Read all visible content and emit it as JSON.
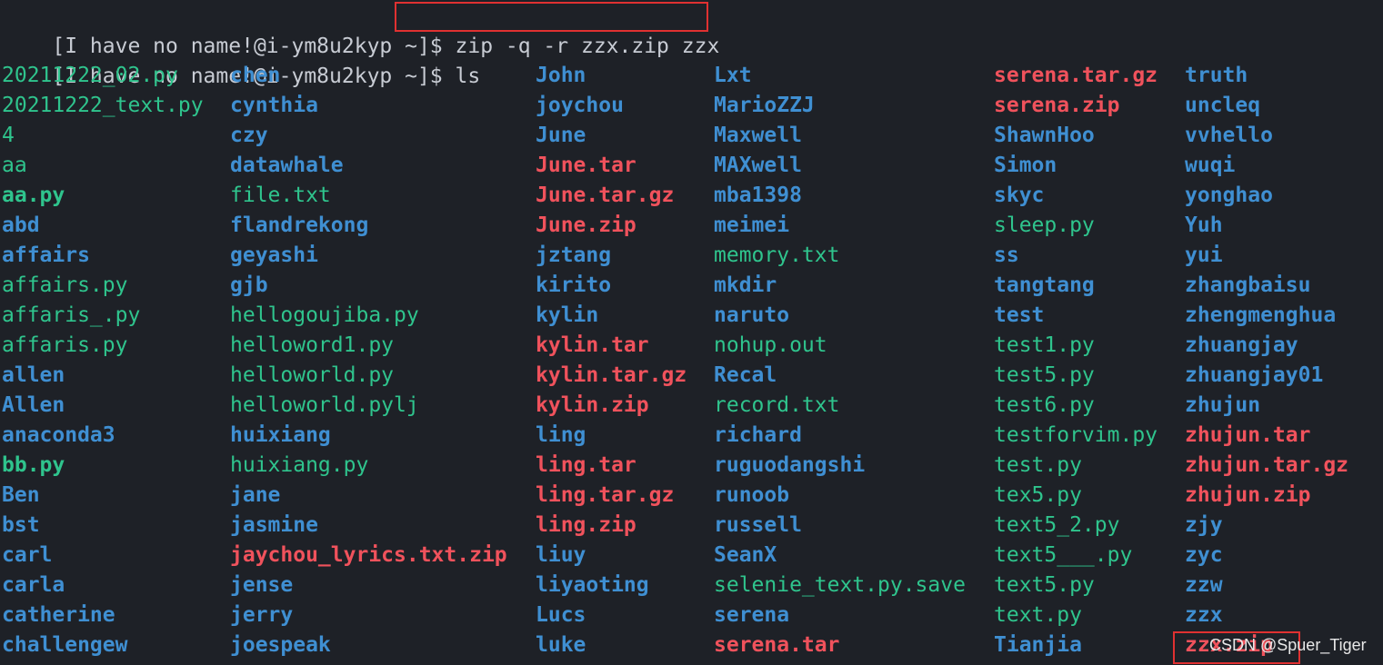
{
  "terminal": {
    "lines": [
      {
        "prompt": "[I have no name!@i-ym8u2kyp ~]$ ",
        "command": "zip -q -r zzx.zip zzx"
      },
      {
        "prompt": "[I have no name!@i-ym8u2kyp ~]$ ",
        "command": "ls"
      }
    ]
  },
  "colors": {
    "background": "#1e2127",
    "file": "#2fc48d",
    "directory": "#3f8fd2",
    "archive": "#f0525c",
    "highlight_box": "#e03131"
  },
  "columns": [
    [
      {
        "name": "20211222_02.py",
        "type": "file"
      },
      {
        "name": "20211222_text.py",
        "type": "file"
      },
      {
        "name": "4",
        "type": "file"
      },
      {
        "name": "aa",
        "type": "file"
      },
      {
        "name": "aa.py",
        "type": "exec"
      },
      {
        "name": "abd",
        "type": "dir"
      },
      {
        "name": "affairs",
        "type": "dir"
      },
      {
        "name": "affairs.py",
        "type": "file"
      },
      {
        "name": "affaris_.py",
        "type": "file"
      },
      {
        "name": "affaris.py",
        "type": "file"
      },
      {
        "name": "allen",
        "type": "dir"
      },
      {
        "name": "Allen",
        "type": "dir"
      },
      {
        "name": "anaconda3",
        "type": "dir"
      },
      {
        "name": "bb.py",
        "type": "exec"
      },
      {
        "name": "Ben",
        "type": "dir"
      },
      {
        "name": "bst",
        "type": "dir"
      },
      {
        "name": "carl",
        "type": "dir"
      },
      {
        "name": "carla",
        "type": "dir"
      },
      {
        "name": "catherine",
        "type": "dir"
      },
      {
        "name": "challengew",
        "type": "dir"
      }
    ],
    [
      {
        "name": "chen",
        "type": "dir"
      },
      {
        "name": "cynthia",
        "type": "dir"
      },
      {
        "name": "czy",
        "type": "dir"
      },
      {
        "name": "datawhale",
        "type": "dir"
      },
      {
        "name": "file.txt",
        "type": "file"
      },
      {
        "name": "flandrekong",
        "type": "dir"
      },
      {
        "name": "geyashi",
        "type": "dir"
      },
      {
        "name": "gjb",
        "type": "dir"
      },
      {
        "name": "hellogoujiba.py",
        "type": "file"
      },
      {
        "name": "helloword1.py",
        "type": "file"
      },
      {
        "name": "helloworld.py",
        "type": "file"
      },
      {
        "name": "helloworld.pylj",
        "type": "file"
      },
      {
        "name": "huixiang",
        "type": "dir"
      },
      {
        "name": "huixiang.py",
        "type": "file"
      },
      {
        "name": "jane",
        "type": "dir"
      },
      {
        "name": "jasmine",
        "type": "dir"
      },
      {
        "name": "jaychou_lyrics.txt.zip",
        "type": "archive"
      },
      {
        "name": "jense",
        "type": "dir"
      },
      {
        "name": "jerry",
        "type": "dir"
      },
      {
        "name": "joespeak",
        "type": "dir"
      }
    ],
    [
      {
        "name": "John",
        "type": "dir"
      },
      {
        "name": "joychou",
        "type": "dir"
      },
      {
        "name": "June",
        "type": "dir"
      },
      {
        "name": "June.tar",
        "type": "archive"
      },
      {
        "name": "June.tar.gz",
        "type": "archive"
      },
      {
        "name": "June.zip",
        "type": "archive"
      },
      {
        "name": "jztang",
        "type": "dir"
      },
      {
        "name": "kirito",
        "type": "dir"
      },
      {
        "name": "kylin",
        "type": "dir"
      },
      {
        "name": "kylin.tar",
        "type": "archive"
      },
      {
        "name": "kylin.tar.gz",
        "type": "archive"
      },
      {
        "name": "kylin.zip",
        "type": "archive"
      },
      {
        "name": "ling",
        "type": "dir"
      },
      {
        "name": "ling.tar",
        "type": "archive"
      },
      {
        "name": "ling.tar.gz",
        "type": "archive"
      },
      {
        "name": "ling.zip",
        "type": "archive"
      },
      {
        "name": "liuy",
        "type": "dir"
      },
      {
        "name": "liyaoting",
        "type": "dir"
      },
      {
        "name": "Lucs",
        "type": "dir"
      },
      {
        "name": "luke",
        "type": "dir"
      }
    ],
    [
      {
        "name": "Lxt",
        "type": "dir"
      },
      {
        "name": "MarioZZJ",
        "type": "dir"
      },
      {
        "name": "Maxwell",
        "type": "dir"
      },
      {
        "name": "MAXwell",
        "type": "dir"
      },
      {
        "name": "mba1398",
        "type": "dir"
      },
      {
        "name": "meimei",
        "type": "dir"
      },
      {
        "name": "memory.txt",
        "type": "file"
      },
      {
        "name": "mkdir",
        "type": "dir"
      },
      {
        "name": "naruto",
        "type": "dir"
      },
      {
        "name": "nohup.out",
        "type": "file"
      },
      {
        "name": "Recal",
        "type": "dir"
      },
      {
        "name": "record.txt",
        "type": "file"
      },
      {
        "name": "richard",
        "type": "dir"
      },
      {
        "name": "ruguodangshi",
        "type": "dir"
      },
      {
        "name": "runoob",
        "type": "dir"
      },
      {
        "name": "russell",
        "type": "dir"
      },
      {
        "name": "SeanX",
        "type": "dir"
      },
      {
        "name": "selenie_text.py.save",
        "type": "file"
      },
      {
        "name": "serena",
        "type": "dir"
      },
      {
        "name": "serena.tar",
        "type": "archive"
      }
    ],
    [
      {
        "name": "serena.tar.gz",
        "type": "archive"
      },
      {
        "name": "serena.zip",
        "type": "archive"
      },
      {
        "name": "ShawnHoo",
        "type": "dir"
      },
      {
        "name": "Simon",
        "type": "dir"
      },
      {
        "name": "skyc",
        "type": "dir"
      },
      {
        "name": "sleep.py",
        "type": "file"
      },
      {
        "name": "ss",
        "type": "dir"
      },
      {
        "name": "tangtang",
        "type": "dir"
      },
      {
        "name": "test",
        "type": "dir"
      },
      {
        "name": "test1.py",
        "type": "file"
      },
      {
        "name": "test5.py",
        "type": "file"
      },
      {
        "name": "test6.py",
        "type": "file"
      },
      {
        "name": "testforvim.py",
        "type": "file"
      },
      {
        "name": "test.py",
        "type": "file"
      },
      {
        "name": "tex5.py",
        "type": "file"
      },
      {
        "name": "text5_2.py",
        "type": "file"
      },
      {
        "name": "text5___.py",
        "type": "file"
      },
      {
        "name": "text5.py",
        "type": "file"
      },
      {
        "name": "text.py",
        "type": "file"
      },
      {
        "name": "Tianjia",
        "type": "dir"
      }
    ],
    [
      {
        "name": "truth",
        "type": "dir"
      },
      {
        "name": "uncleq",
        "type": "dir"
      },
      {
        "name": "vvhello",
        "type": "dir"
      },
      {
        "name": "wuqi",
        "type": "dir"
      },
      {
        "name": "yonghao",
        "type": "dir"
      },
      {
        "name": "Yuh",
        "type": "dir"
      },
      {
        "name": "yui",
        "type": "dir"
      },
      {
        "name": "zhangbaisu",
        "type": "dir"
      },
      {
        "name": "zhengmenghua",
        "type": "dir"
      },
      {
        "name": "zhuangjay",
        "type": "dir"
      },
      {
        "name": "zhuangjay01",
        "type": "dir"
      },
      {
        "name": "zhujun",
        "type": "dir"
      },
      {
        "name": "zhujun.tar",
        "type": "archive"
      },
      {
        "name": "zhujun.tar.gz",
        "type": "archive"
      },
      {
        "name": "zhujun.zip",
        "type": "archive"
      },
      {
        "name": "zjy",
        "type": "dir"
      },
      {
        "name": "zyc",
        "type": "dir"
      },
      {
        "name": "zzw",
        "type": "dir"
      },
      {
        "name": "zzx",
        "type": "dir"
      },
      {
        "name": "zzx.zip",
        "type": "archive"
      }
    ]
  ],
  "watermark": "CSDN @Spuer_Tiger"
}
